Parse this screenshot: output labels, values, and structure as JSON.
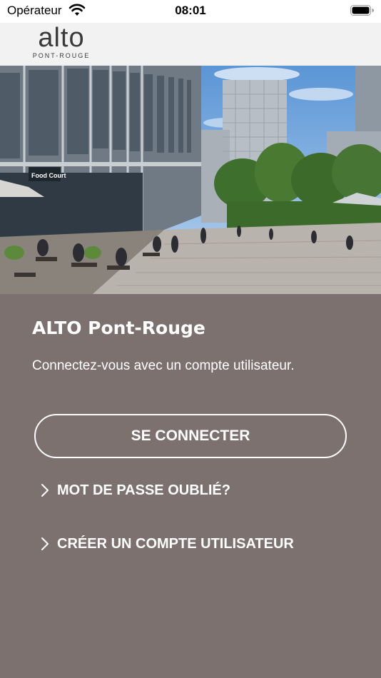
{
  "status_bar": {
    "carrier": "Opérateur",
    "time": "08:01"
  },
  "header": {
    "logo_text": "alto",
    "logo_subtext": "PONT-ROUGE"
  },
  "hero": {
    "sign_text": "Food Court"
  },
  "main": {
    "title": "ALTO Pont-Rouge",
    "subtitle": "Connectez-vous avec un compte utilisateur.",
    "login_button": "SE CONNECTER",
    "forgot_password": "MOT DE PASSE OUBLIÉ?",
    "create_account": "CRÉER UN COMPTE UTILISATEUR"
  },
  "colors": {
    "background": "#7c716f",
    "header": "#f2f2f2",
    "text": "#ffffff"
  }
}
